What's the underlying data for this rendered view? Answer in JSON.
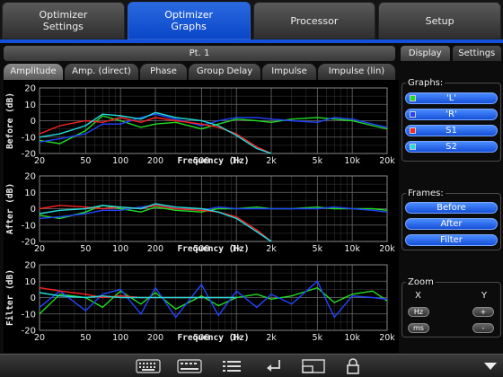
{
  "top_tabs": [
    {
      "label": "Optimizer\nSettings",
      "active": false
    },
    {
      "label": "Optimizer\nGraphs",
      "active": true
    },
    {
      "label": "Processor",
      "active": false
    },
    {
      "label": "Setup",
      "active": false
    }
  ],
  "point_label": "Pt. 1",
  "sub_tabs": [
    "Amplitude",
    "Amp. (direct)",
    "Phase",
    "Group Delay",
    "Impulse",
    "Impulse (lin)"
  ],
  "right_tabs": [
    "Display",
    "Settings"
  ],
  "graphs_group": {
    "title": "Graphs:",
    "items": [
      {
        "label": "'L'",
        "color": "#22dd22"
      },
      {
        "label": "'R'",
        "color": "#2244ff"
      },
      {
        "label": "S1",
        "color": "#ff2222"
      },
      {
        "label": "S2",
        "color": "#22dddd"
      }
    ]
  },
  "frames_group": {
    "title": "Frames:",
    "items": [
      "Before",
      "After",
      "Filter"
    ]
  },
  "zoom_group": {
    "title": "Zoom",
    "x_label": "X",
    "y_label": "Y",
    "x_buttons": [
      "Hz",
      "ms"
    ],
    "y_buttons": [
      "+",
      "-"
    ]
  },
  "chart_data": [
    {
      "type": "line",
      "ylabel": "Before (dB)",
      "xlabel": "Frequency (Hz)",
      "x_ticks": [
        "20",
        "50",
        "100",
        "200",
        "500",
        "1k",
        "2k",
        "5k",
        "10k",
        "20k"
      ],
      "y_ticks": [
        "20",
        "10",
        "0",
        "-10",
        "-20"
      ],
      "xlim": [
        20,
        20000
      ],
      "ylim": [
        -20,
        20
      ],
      "x_scale": "log",
      "grid": true,
      "x": [
        20,
        30,
        50,
        70,
        100,
        150,
        200,
        300,
        500,
        700,
        1000,
        1500,
        2000,
        3000,
        5000,
        7000,
        10000,
        15000,
        20000
      ],
      "series": [
        {
          "name": "'L'",
          "color": "#22dd22",
          "values": [
            -12,
            -14,
            -6,
            3,
            0,
            -4,
            -2,
            -1,
            -5,
            -2,
            1,
            0,
            -1,
            1,
            2,
            1,
            0,
            -3,
            -5
          ]
        },
        {
          "name": "'R'",
          "color": "#2244ff",
          "values": [
            -13,
            -11,
            -8,
            -2,
            -2,
            2,
            4,
            1,
            -3,
            0,
            2,
            2,
            1,
            0,
            -1,
            2,
            1,
            -2,
            -4
          ]
        },
        {
          "name": "S1",
          "color": "#ff2222",
          "values": [
            -8,
            -3,
            0,
            -1,
            2,
            -1,
            2,
            0,
            -2,
            -4,
            -8,
            -16,
            -20,
            null,
            null,
            null,
            null,
            null,
            null
          ]
        },
        {
          "name": "S2",
          "color": "#22dddd",
          "values": [
            -10,
            -8,
            -3,
            4,
            3,
            1,
            5,
            2,
            0,
            -3,
            -9,
            -17,
            -20,
            null,
            null,
            null,
            null,
            null,
            null
          ]
        }
      ]
    },
    {
      "type": "line",
      "ylabel": "After (dB)",
      "xlabel": "Frequency (Hz)",
      "x_ticks": [
        "20",
        "50",
        "100",
        "200",
        "500",
        "1k",
        "2k",
        "5k",
        "10k",
        "20k"
      ],
      "y_ticks": [
        "20",
        "10",
        "0",
        "-10",
        "-20"
      ],
      "xlim": [
        20,
        20000
      ],
      "ylim": [
        -20,
        20
      ],
      "x_scale": "log",
      "grid": true,
      "x": [
        20,
        30,
        50,
        70,
        100,
        150,
        200,
        300,
        500,
        700,
        1000,
        1500,
        2000,
        3000,
        5000,
        7000,
        10000,
        15000,
        20000
      ],
      "series": [
        {
          "name": "'L'",
          "color": "#22dd22",
          "values": [
            -4,
            -6,
            -2,
            2,
            0,
            -2,
            1,
            -1,
            -2,
            0,
            0,
            1,
            0,
            0,
            1,
            0,
            0,
            0,
            -1
          ]
        },
        {
          "name": "'R'",
          "color": "#2244ff",
          "values": [
            -6,
            -5,
            -3,
            -1,
            -1,
            1,
            2,
            0,
            -1,
            1,
            0,
            0,
            0,
            0,
            0,
            1,
            0,
            -1,
            -2
          ]
        },
        {
          "name": "S1",
          "color": "#ff2222",
          "values": [
            0,
            2,
            1,
            0,
            1,
            0,
            2,
            0,
            -1,
            -2,
            -5,
            -13,
            -20,
            null,
            null,
            null,
            null,
            null,
            null
          ]
        },
        {
          "name": "S2",
          "color": "#22dddd",
          "values": [
            -3,
            -1,
            0,
            2,
            1,
            0,
            3,
            1,
            0,
            -2,
            -6,
            -14,
            -20,
            null,
            null,
            null,
            null,
            null,
            null
          ]
        }
      ]
    },
    {
      "type": "line",
      "ylabel": "Filter (dB)",
      "xlabel": "Frequency (Hz)",
      "x_ticks": [
        "20",
        "50",
        "100",
        "200",
        "500",
        "1k",
        "2k",
        "5k",
        "10k",
        "20k"
      ],
      "y_ticks": [
        "20",
        "10",
        "0",
        "-10",
        "-20"
      ],
      "xlim": [
        20,
        20000
      ],
      "ylim": [
        -20,
        20
      ],
      "x_scale": "log",
      "grid": true,
      "x": [
        20,
        30,
        50,
        70,
        100,
        150,
        200,
        300,
        500,
        700,
        1000,
        1500,
        2000,
        3000,
        5000,
        7000,
        10000,
        15000,
        20000
      ],
      "series": [
        {
          "name": "'L'",
          "color": "#22dd22",
          "values": [
            -10,
            2,
            0,
            -6,
            4,
            -4,
            3,
            -7,
            1,
            -5,
            0,
            2,
            -1,
            1,
            6,
            -3,
            2,
            4,
            -2
          ]
        },
        {
          "name": "'R'",
          "color": "#2244ff",
          "values": [
            -6,
            4,
            -8,
            2,
            5,
            -10,
            6,
            -12,
            8,
            -11,
            4,
            -6,
            2,
            -4,
            10,
            -12,
            1,
            0,
            -1
          ]
        },
        {
          "name": "S1",
          "color": "#ff2222",
          "values": [
            6,
            4,
            2,
            0,
            1,
            0,
            0,
            0,
            0,
            0,
            0,
            null,
            null,
            null,
            null,
            null,
            null,
            null,
            null
          ]
        },
        {
          "name": "S2",
          "color": "#22dddd",
          "values": [
            3,
            1,
            0,
            1,
            0,
            0,
            0,
            0,
            0,
            0,
            0,
            null,
            null,
            null,
            null,
            null,
            null,
            null,
            null
          ]
        }
      ]
    }
  ]
}
